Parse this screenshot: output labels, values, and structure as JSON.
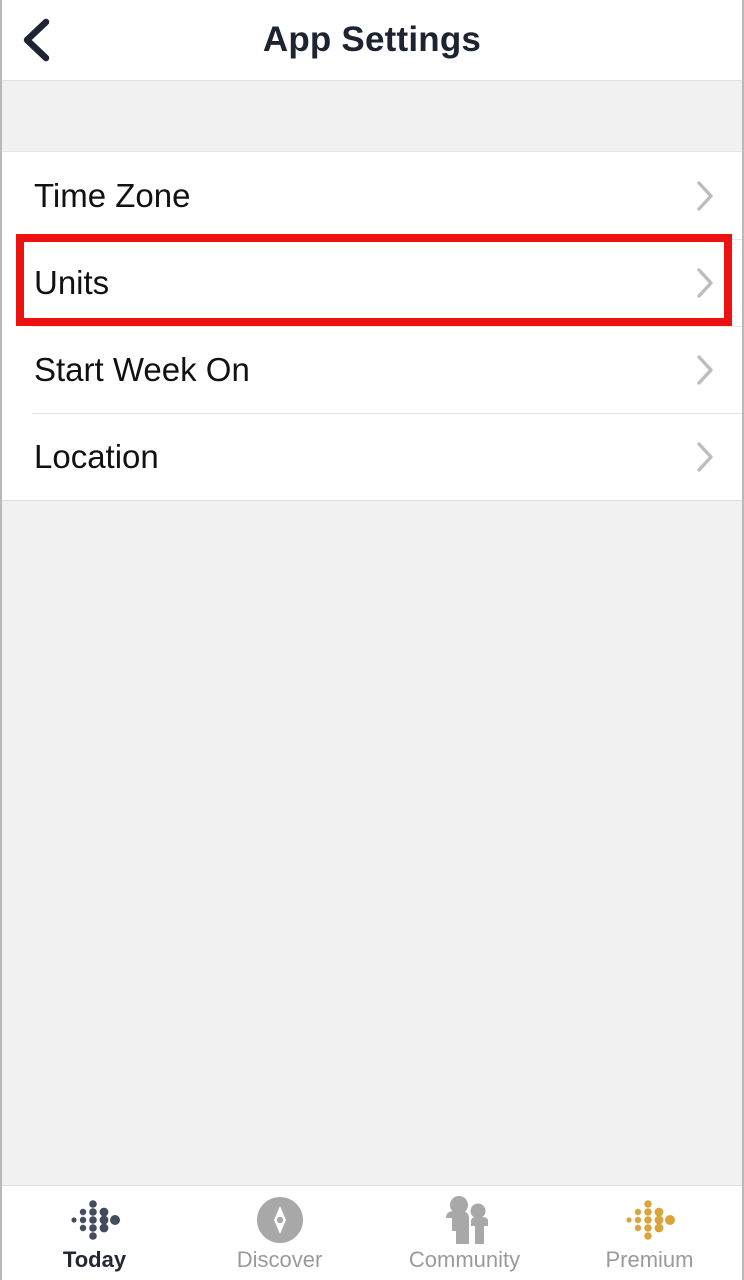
{
  "header": {
    "title": "App Settings",
    "back_icon": "chevron-left-icon"
  },
  "settings_list": {
    "items": [
      {
        "label": "Time Zone",
        "chevron": "chevron-right-icon",
        "highlighted": true
      },
      {
        "label": "Units",
        "chevron": "chevron-right-icon",
        "highlighted": false
      },
      {
        "label": "Start Week On",
        "chevron": "chevron-right-icon",
        "highlighted": false
      },
      {
        "label": "Location",
        "chevron": "chevron-right-icon",
        "highlighted": false
      }
    ]
  },
  "annotation": {
    "target": "Time Zone",
    "color": "#ee1111"
  },
  "tabbar": {
    "tabs": [
      {
        "label": "Today",
        "icon": "fitbit-dots-icon",
        "active": true
      },
      {
        "label": "Discover",
        "icon": "compass-icon",
        "active": false
      },
      {
        "label": "Community",
        "icon": "people-icon",
        "active": false
      },
      {
        "label": "Premium",
        "icon": "fitbit-dots-gold-icon",
        "active": false
      }
    ]
  },
  "colors": {
    "page_background": "#f1f1f1",
    "card_background": "#ffffff",
    "text_primary": "#111111",
    "text_muted": "#9a9a9a",
    "today_icon": "#454b5e",
    "premium_icon": "#d8a53c",
    "inactive_icon": "#a8a8a8",
    "annotation": "#ee1111"
  }
}
